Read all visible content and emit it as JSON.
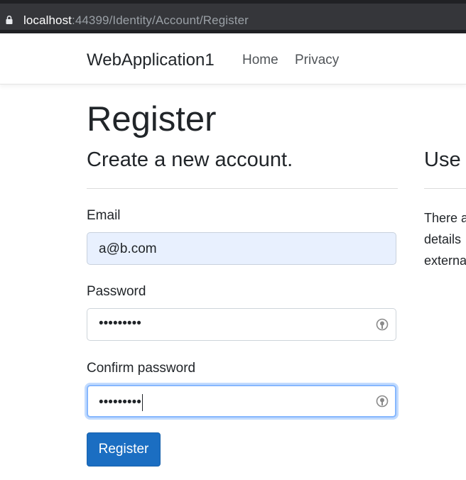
{
  "browser": {
    "url_host": "localhost",
    "url_rest": ":44399/Identity/Account/Register"
  },
  "navbar": {
    "brand": "WebApplication1",
    "links": [
      "Home",
      "Privacy"
    ]
  },
  "main": {
    "title": "Register",
    "subtitle": "Create a new account.",
    "right_heading": "Use",
    "right_text_lines": [
      "There a",
      "details",
      "externa"
    ]
  },
  "form": {
    "email_label": "Email",
    "email_value": "a@b.com",
    "password_label": "Password",
    "password_value": "•••••••••",
    "confirm_label": "Confirm password",
    "confirm_value": "•••••••••",
    "submit_label": "Register"
  },
  "colors": {
    "primary_button": "#1b6ec2",
    "autofill_bg": "#e8f0fe",
    "focus_ring": "#86b7fe"
  },
  "icons": {
    "lock": "lock-icon",
    "password_manager": "password-manager-icon"
  }
}
